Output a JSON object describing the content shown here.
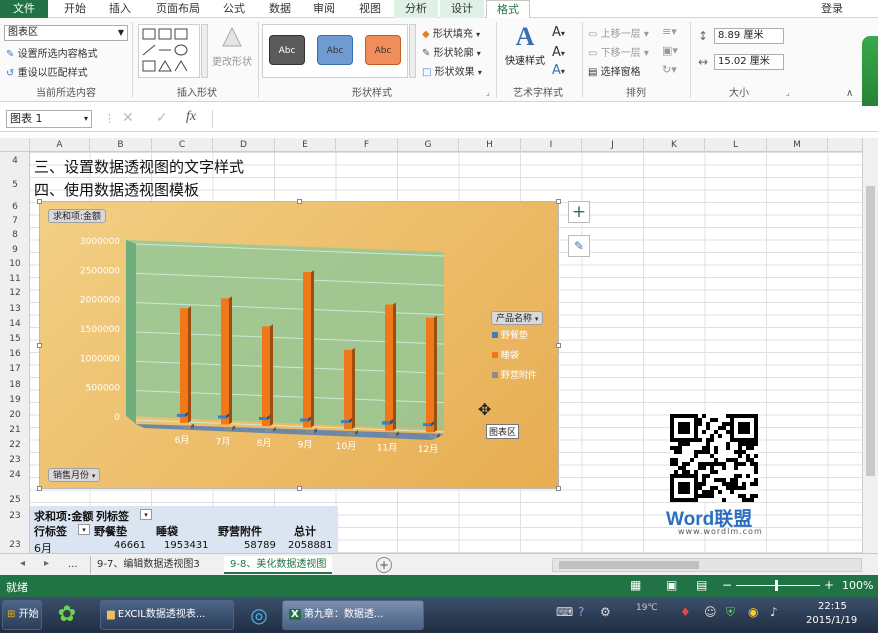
{
  "ribbon": {
    "tabs": [
      "文件",
      "开始",
      "插入",
      "页面布局",
      "公式",
      "数据",
      "审阅",
      "视图",
      "分析",
      "设计",
      "格式"
    ],
    "user": "登录",
    "current_selection": {
      "dropdown": "图表区",
      "format_selection": "设置所选内容格式",
      "reset_match": "重设以匹配样式",
      "label": "当前所选内容"
    },
    "insert_shapes": {
      "change_shape": "更改形状",
      "label": "插入形状"
    },
    "shape_styles": {
      "presets": [
        "Abc",
        "Abc",
        "Abc"
      ],
      "colors": [
        "#5a5a5a",
        "#6f9bd1",
        "#f08d5a"
      ],
      "fill": "形状填充",
      "outline": "形状轮廓",
      "effects": "形状效果",
      "label": "形状样式"
    },
    "wordart": {
      "quick_styles": "快速样式",
      "label": "艺术字样式"
    },
    "arrange": {
      "bring_forward": "上移一层",
      "send_backward": "下移一层",
      "selection_pane": "选择窗格",
      "label": "排列"
    },
    "size": {
      "height": "8.89 厘米",
      "width": "15.02 厘米",
      "label": "大小"
    }
  },
  "formula_bar": {
    "name_box": "图表 1",
    "fx": "fx",
    "value": ""
  },
  "grid": {
    "columns": [
      "A",
      "B",
      "C",
      "D",
      "E",
      "F",
      "G",
      "H",
      "I",
      "J",
      "K",
      "L",
      "M"
    ],
    "rows": [
      "4",
      "5",
      "6",
      "7",
      "8",
      "9",
      "10",
      "11",
      "12",
      "13",
      "14",
      "15",
      "16",
      "17",
      "18",
      "19",
      "20",
      "21",
      "22",
      "23",
      "24",
      "25",
      "23",
      "23"
    ],
    "row4_text": "三、设置数据透视图的文字样式",
    "row5_text": "四、使用数据透视图模板"
  },
  "chart": {
    "value_field_button": "求和项:金额",
    "axis_field_button": "销售月份",
    "legend_field_button": "产品名称",
    "tooltip": "图表区",
    "watermark_brand": "Word联盟",
    "watermark_url": "www.wordlm.com"
  },
  "chart_data": {
    "type": "bar",
    "categories": [
      "6月",
      "7月",
      "8月",
      "9月",
      "10月",
      "11月",
      "12月"
    ],
    "series": [
      {
        "name": "野餐垫",
        "values": [
          46661,
          48000,
          40000,
          42000,
          38000,
          60000,
          50000
        ]
      },
      {
        "name": "睡袋",
        "values": [
          1953431,
          2150000,
          1700000,
          2650000,
          1350000,
          2150000,
          1950000
        ]
      },
      {
        "name": "野营附件",
        "values": [
          58789,
          52000,
          48000,
          60000,
          45000,
          55000,
          50000
        ]
      }
    ],
    "colors": [
      "#3f7fc0",
      "#f07818",
      "#8c8c8c"
    ],
    "yticks": [
      "3000000",
      "2500000",
      "2000000",
      "1500000",
      "1000000",
      "500000",
      "0"
    ],
    "ylim": [
      0,
      3000000
    ],
    "legend": "right"
  },
  "pivot": {
    "header": [
      "求和项:金额",
      "列标签"
    ],
    "row_label": "行标签",
    "columns": [
      "野餐垫",
      "睡袋",
      "野营附件",
      "总计"
    ],
    "row": [
      "6月",
      "46661",
      "1953431",
      "58789",
      "2058881"
    ]
  },
  "sheet_tabs": [
    "...",
    "9-7、编辑数据透视图3",
    "9-8、美化数据透视图"
  ],
  "status": {
    "ready": "就绪",
    "zoom": "100%"
  },
  "taskbar": {
    "start": "开始",
    "items": [
      "EXCIL数据透视表...",
      "第九章：数据透..."
    ],
    "time": "22:15",
    "date": "2015/1/19",
    "weather": "19℃"
  }
}
